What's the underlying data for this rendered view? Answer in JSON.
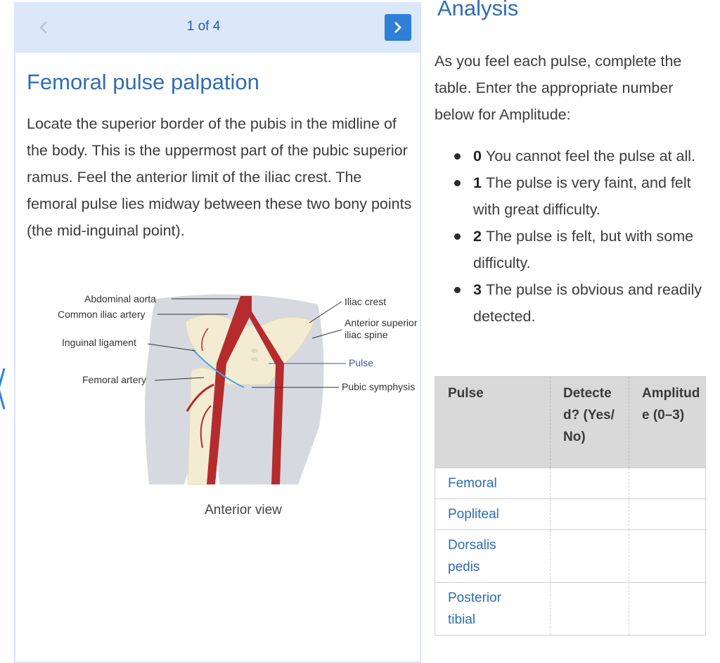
{
  "carousel": {
    "pager": "1 of 4",
    "title": "Femoral pulse palpation",
    "body": "Locate the superior border of the pubis in the midline of the body. This is the uppermost part of the pubic superior ramus. Feel the anterior limit of the iliac crest. The femoral pulse lies midway between these two bony points (the mid-inguinal point).",
    "figure": {
      "labels": {
        "abdominal_aorta": "Abdominal aorta",
        "common_iliac_artery": "Common iliac artery",
        "inguinal_ligament": "Inguinal ligament",
        "femoral_artery": "Femoral artery",
        "iliac_crest": "Iliac crest",
        "anterior_superior_iliac_spine_line1": "Anterior superior",
        "anterior_superior_iliac_spine_line2": "iliac spine",
        "pulse": "Pulse",
        "pubic_symphysis": "Pubic symphysis"
      },
      "caption": "Anterior view"
    }
  },
  "analysis": {
    "title": "Analysis",
    "intro": "As you feel each pulse, complete the table. Enter the appropriate number below for Amplitude:",
    "levels": [
      {
        "num": "0",
        "text": "You cannot feel the pulse at all."
      },
      {
        "num": "1",
        "text": "The pulse is very faint, and felt with great difficulty."
      },
      {
        "num": "2",
        "text": "The pulse is felt, but with some difficulty."
      },
      {
        "num": "3",
        "text": "The pulse is obvious and readily detected."
      }
    ],
    "table": {
      "headers": [
        "Pulse",
        "Detected? (Yes/No)",
        "Amplitude (0–3)"
      ],
      "rows": [
        {
          "pulse": "Femoral",
          "detected": "",
          "amplitude": ""
        },
        {
          "pulse": "Popliteal",
          "detected": "",
          "amplitude": ""
        },
        {
          "pulse": "Dorsalis pedis",
          "detected": "",
          "amplitude": ""
        },
        {
          "pulse": "Posterior tibial",
          "detected": "",
          "amplitude": ""
        }
      ]
    }
  },
  "icons": {
    "prev": "chevron-left-icon",
    "next": "chevron-right-icon",
    "side": "chevron-left-icon"
  },
  "colors": {
    "accent": "#2f6db3",
    "header_bg": "#dbe8fa",
    "next_button": "#2f7fd6",
    "artery": "#b52b2e",
    "bone": "#f3ecd3",
    "body_silhouette": "#d6d9df",
    "pulse_line": "#4aa6e0"
  }
}
